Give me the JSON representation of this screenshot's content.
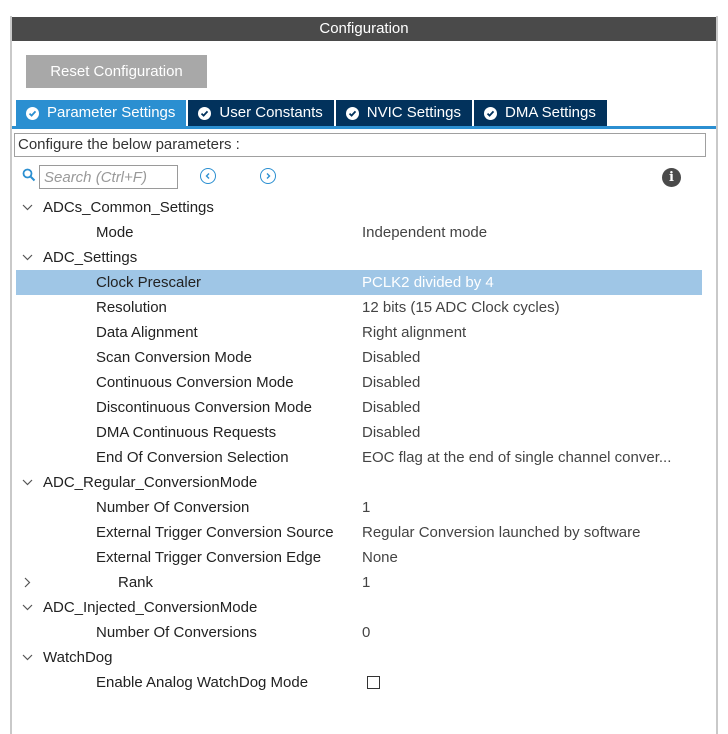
{
  "window": {
    "title": "Configuration"
  },
  "toolbar": {
    "reset_label": "Reset Configuration"
  },
  "tabs": [
    {
      "label": "Parameter Settings",
      "active": true
    },
    {
      "label": "User Constants",
      "active": false
    },
    {
      "label": "NVIC Settings",
      "active": false
    },
    {
      "label": "DMA Settings",
      "active": false
    }
  ],
  "description": "Configure the below parameters :",
  "search": {
    "placeholder": "Search (Ctrl+F)",
    "value": ""
  },
  "icons": {
    "search": "search-icon",
    "prev": "chevron-left-circle-icon",
    "next": "chevron-right-circle-icon",
    "info": "info-icon"
  },
  "colors": {
    "title_bar": "#4a4a4a",
    "tab_active": "#2b8fd1",
    "tab_inactive": "#02325c",
    "selection": "#9fc6e6",
    "reset_button": "#a8a8a8"
  },
  "groups": [
    {
      "name": "ADCs_Common_Settings",
      "expanded": true,
      "params": [
        {
          "name": "Mode",
          "value": "Independent mode"
        }
      ]
    },
    {
      "name": "ADC_Settings",
      "expanded": true,
      "params": [
        {
          "name": "Clock Prescaler",
          "value": "PCLK2 divided by 4",
          "selected": true
        },
        {
          "name": "Resolution",
          "value": "12 bits (15 ADC Clock cycles)"
        },
        {
          "name": "Data Alignment",
          "value": "Right alignment"
        },
        {
          "name": "Scan Conversion Mode",
          "value": "Disabled"
        },
        {
          "name": "Continuous Conversion Mode",
          "value": "Disabled"
        },
        {
          "name": "Discontinuous Conversion Mode",
          "value": "Disabled"
        },
        {
          "name": "DMA Continuous Requests",
          "value": "Disabled"
        },
        {
          "name": "End Of Conversion Selection",
          "value": "EOC flag at the end of single channel conver..."
        }
      ]
    },
    {
      "name": "ADC_Regular_ConversionMode",
      "expanded": true,
      "params": [
        {
          "name": "Number Of Conversion",
          "value": "1"
        },
        {
          "name": "External Trigger Conversion Source",
          "value": "Regular Conversion launched by software"
        },
        {
          "name": "External Trigger Conversion Edge",
          "value": "None"
        },
        {
          "name": "Rank",
          "value": "1",
          "collapsed_subgroup": true
        }
      ]
    },
    {
      "name": "ADC_Injected_ConversionMode",
      "expanded": true,
      "params": [
        {
          "name": "Number Of Conversions",
          "value": "0"
        }
      ]
    },
    {
      "name": "WatchDog",
      "expanded": true,
      "params": [
        {
          "name": "Enable Analog WatchDog Mode",
          "checkbox": true,
          "checked": false
        }
      ]
    }
  ]
}
